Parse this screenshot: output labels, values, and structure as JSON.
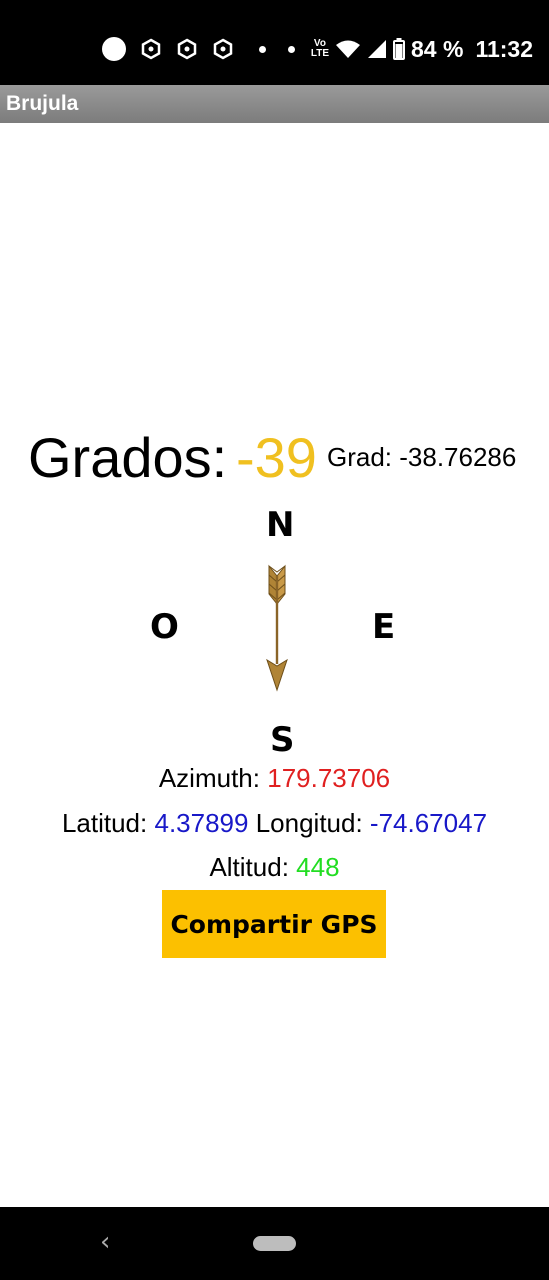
{
  "status_bar": {
    "battery": "84 %",
    "time": "11:32",
    "volte_top": "Vo",
    "volte_bottom": "LTE"
  },
  "app": {
    "title": "Brujula"
  },
  "compass": {
    "grados_label": "Grados:",
    "grados_value": "-39",
    "grad_text": "Grad: -38.76286",
    "north": "N",
    "south": "S",
    "east": "E",
    "west": "O",
    "needle_icon": "arrow-needle-icon"
  },
  "info": {
    "azimuth_label": "Azimuth:",
    "azimuth_value": "179.73706",
    "latitud_label": "Latitud:",
    "latitud_value": "4.37899",
    "longitud_label": "Longitud:",
    "longitud_value": "-74.67047",
    "altitud_label": "Altitud:",
    "altitud_value": "448"
  },
  "actions": {
    "share_label": "Compartir GPS"
  },
  "colors": {
    "grados_value": "#f0c020",
    "azimuth_value": "#e02020",
    "coords_value": "#1818c8",
    "altitud_value": "#22dd22",
    "button_bg": "#fcc000"
  }
}
